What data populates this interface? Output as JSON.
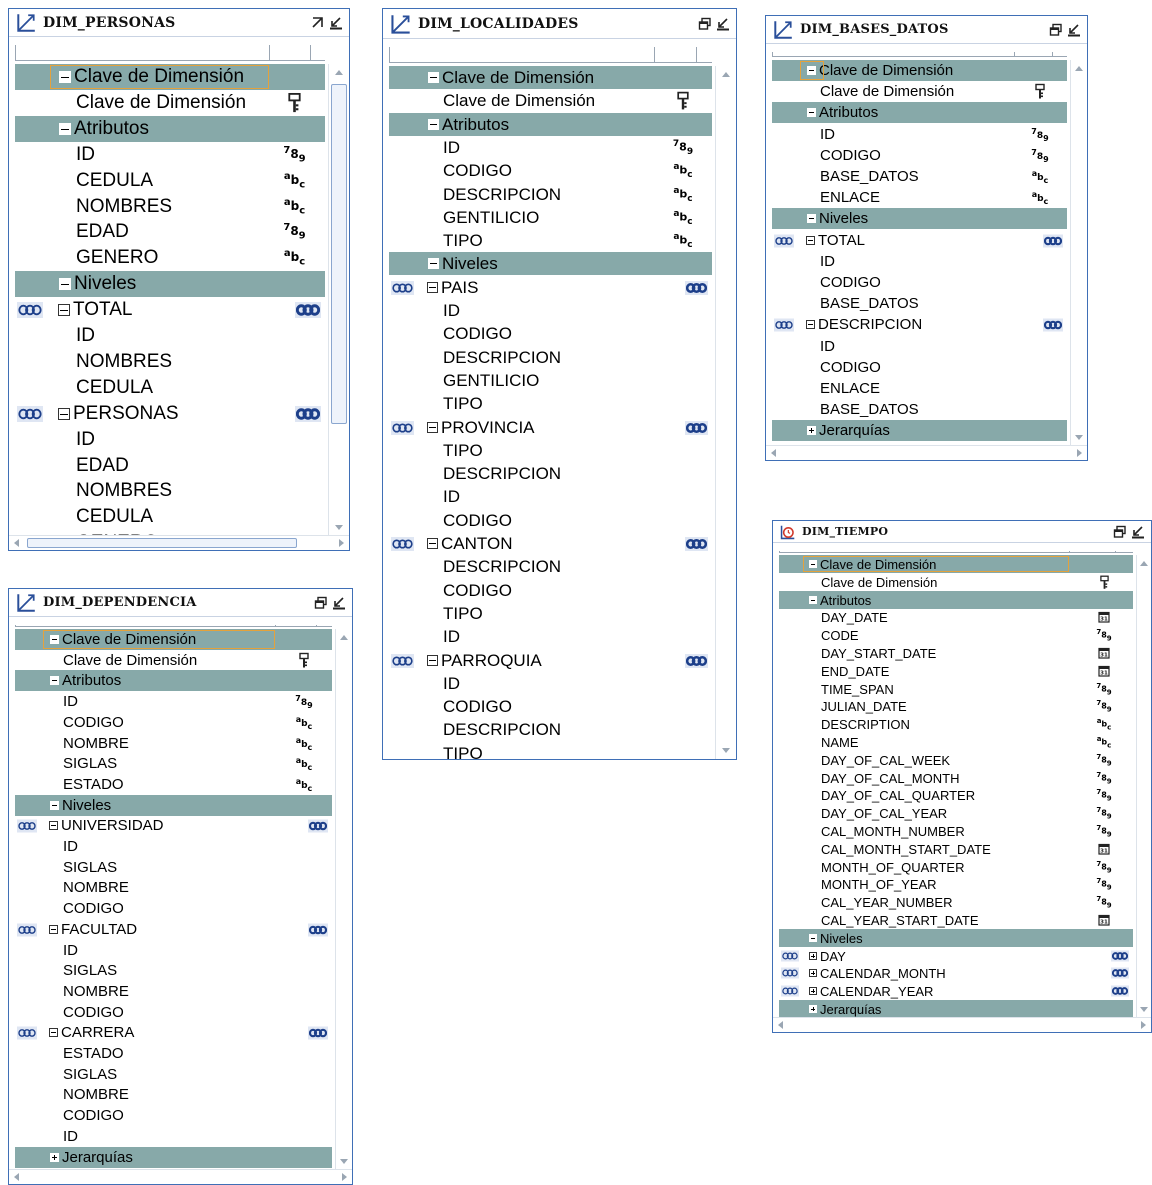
{
  "panels": [
    {
      "id": "dim-personas",
      "title": "DIM_PERSONAS",
      "badge_button": "arrow",
      "sections": [
        {
          "label": "Clave de Dimensión",
          "state": "expanded",
          "selected": true
        },
        {
          "label": "Clave de Dimensión",
          "type": "key"
        },
        {
          "label": "Atributos",
          "state": "expanded"
        },
        {
          "label": "ID",
          "type": "number"
        },
        {
          "label": "CEDULA",
          "type": "text"
        },
        {
          "label": "NOMBRES",
          "type": "text"
        },
        {
          "label": "EDAD",
          "type": "number"
        },
        {
          "label": "GENERO",
          "type": "text"
        },
        {
          "label": "Niveles",
          "state": "expanded"
        },
        {
          "label": "TOTAL",
          "level": true,
          "state": "expanded"
        },
        {
          "label": "ID"
        },
        {
          "label": "NOMBRES"
        },
        {
          "label": "CEDULA"
        },
        {
          "label": "PERSONAS",
          "level": true,
          "state": "expanded"
        },
        {
          "label": "ID"
        },
        {
          "label": "EDAD"
        },
        {
          "label": "NOMBRES"
        },
        {
          "label": "CEDULA"
        },
        {
          "label": "GENERO"
        }
      ]
    },
    {
      "id": "dim-localidades",
      "title": "DIM_LOCALIDADES",
      "sections": [
        {
          "label": "Clave de Dimensión",
          "state": "expanded"
        },
        {
          "label": "Clave de Dimensión",
          "type": "key"
        },
        {
          "label": "Atributos",
          "state": "expanded"
        },
        {
          "label": "ID",
          "type": "number"
        },
        {
          "label": "CODIGO",
          "type": "text"
        },
        {
          "label": "DESCRIPCION",
          "type": "text"
        },
        {
          "label": "GENTILICIO",
          "type": "text"
        },
        {
          "label": "TIPO",
          "type": "text"
        },
        {
          "label": "Niveles",
          "state": "expanded"
        },
        {
          "label": "PAIS",
          "level": true,
          "state": "expanded"
        },
        {
          "label": "ID"
        },
        {
          "label": "CODIGO"
        },
        {
          "label": "DESCRIPCION"
        },
        {
          "label": "GENTILICIO"
        },
        {
          "label": "TIPO"
        },
        {
          "label": "PROVINCIA",
          "level": true,
          "state": "expanded"
        },
        {
          "label": "TIPO"
        },
        {
          "label": "DESCRIPCION"
        },
        {
          "label": "ID"
        },
        {
          "label": "CODIGO"
        },
        {
          "label": "CANTON",
          "level": true,
          "state": "expanded"
        },
        {
          "label": "DESCRIPCION"
        },
        {
          "label": "CODIGO"
        },
        {
          "label": "TIPO"
        },
        {
          "label": "ID"
        },
        {
          "label": "PARROQUIA",
          "level": true,
          "state": "expanded"
        },
        {
          "label": "ID"
        },
        {
          "label": "CODIGO"
        },
        {
          "label": "DESCRIPCION"
        },
        {
          "label": "TIPO"
        }
      ]
    },
    {
      "id": "dim-bases-datos",
      "title": "DIM_BASES_DATOS",
      "sections": [
        {
          "label": "Clave de Dimensión",
          "state": "expanded",
          "selected": true
        },
        {
          "label": "Clave de Dimensión",
          "type": "key"
        },
        {
          "label": "Atributos",
          "state": "expanded"
        },
        {
          "label": "ID",
          "type": "number"
        },
        {
          "label": "CODIGO",
          "type": "number"
        },
        {
          "label": "BASE_DATOS",
          "type": "text"
        },
        {
          "label": "ENLACE",
          "type": "text"
        },
        {
          "label": "Niveles",
          "state": "expanded"
        },
        {
          "label": "TOTAL",
          "level": true,
          "state": "expanded"
        },
        {
          "label": "ID"
        },
        {
          "label": "CODIGO"
        },
        {
          "label": "BASE_DATOS"
        },
        {
          "label": "DESCRIPCION",
          "level": true,
          "state": "expanded"
        },
        {
          "label": "ID"
        },
        {
          "label": "CODIGO"
        },
        {
          "label": "ENLACE"
        },
        {
          "label": "BASE_DATOS"
        },
        {
          "label": "Jerarquías",
          "state": "collapsed"
        }
      ]
    },
    {
      "id": "dim-dependencia",
      "title": "DIM_DEPENDENCIA",
      "sections": [
        {
          "label": "Clave de Dimensión",
          "state": "expanded",
          "selected": true
        },
        {
          "label": "Clave de Dimensión",
          "type": "key"
        },
        {
          "label": "Atributos",
          "state": "expanded"
        },
        {
          "label": "ID",
          "type": "number"
        },
        {
          "label": "CODIGO",
          "type": "text"
        },
        {
          "label": "NOMBRE",
          "type": "text"
        },
        {
          "label": "SIGLAS",
          "type": "text"
        },
        {
          "label": "ESTADO",
          "type": "text"
        },
        {
          "label": "Niveles",
          "state": "expanded"
        },
        {
          "label": "UNIVERSIDAD",
          "level": true,
          "state": "expanded"
        },
        {
          "label": "ID"
        },
        {
          "label": "SIGLAS"
        },
        {
          "label": "NOMBRE"
        },
        {
          "label": "CODIGO"
        },
        {
          "label": "FACULTAD",
          "level": true,
          "state": "expanded"
        },
        {
          "label": "ID"
        },
        {
          "label": "SIGLAS"
        },
        {
          "label": "NOMBRE"
        },
        {
          "label": "CODIGO"
        },
        {
          "label": "CARRERA",
          "level": true,
          "state": "expanded"
        },
        {
          "label": "ESTADO"
        },
        {
          "label": "SIGLAS"
        },
        {
          "label": "NOMBRE"
        },
        {
          "label": "CODIGO"
        },
        {
          "label": "ID"
        },
        {
          "label": "Jerarquías",
          "state": "collapsed"
        }
      ]
    },
    {
      "id": "dim-tiempo",
      "title": "DIM_TIEMPO",
      "sections": [
        {
          "label": "Clave de Dimensión",
          "state": "expanded",
          "selected": true
        },
        {
          "label": "Clave de Dimensión",
          "type": "key"
        },
        {
          "label": "Atributos",
          "state": "expanded"
        },
        {
          "label": "DAY_DATE",
          "type": "date"
        },
        {
          "label": "CODE",
          "type": "number"
        },
        {
          "label": "DAY_START_DATE",
          "type": "date"
        },
        {
          "label": "END_DATE",
          "type": "date"
        },
        {
          "label": "TIME_SPAN",
          "type": "number"
        },
        {
          "label": "JULIAN_DATE",
          "type": "number"
        },
        {
          "label": "DESCRIPTION",
          "type": "text"
        },
        {
          "label": "NAME",
          "type": "text"
        },
        {
          "label": "DAY_OF_CAL_WEEK",
          "type": "number"
        },
        {
          "label": "DAY_OF_CAL_MONTH",
          "type": "number"
        },
        {
          "label": "DAY_OF_CAL_QUARTER",
          "type": "number"
        },
        {
          "label": "DAY_OF_CAL_YEAR",
          "type": "number"
        },
        {
          "label": "CAL_MONTH_NUMBER",
          "type": "number"
        },
        {
          "label": "CAL_MONTH_START_DATE",
          "type": "date"
        },
        {
          "label": "MONTH_OF_QUARTER",
          "type": "number"
        },
        {
          "label": "MONTH_OF_YEAR",
          "type": "number"
        },
        {
          "label": "CAL_YEAR_NUMBER",
          "type": "number"
        },
        {
          "label": "CAL_YEAR_START_DATE",
          "type": "date"
        },
        {
          "label": "Niveles",
          "state": "expanded"
        },
        {
          "label": "DAY",
          "level": true,
          "state": "collapsed"
        },
        {
          "label": "CALENDAR_MONTH",
          "level": true,
          "state": "collapsed"
        },
        {
          "label": "CALENDAR_YEAR",
          "level": true,
          "state": "collapsed"
        },
        {
          "label": "Jerarquías",
          "state": "collapsed"
        }
      ]
    }
  ],
  "type_glyphs": {
    "key": "key-icon",
    "number": "789",
    "text": "abc",
    "date": "31",
    "level": "hierarchy-chain-icon"
  },
  "colors": {
    "section_bg": "#87a9a9",
    "border": "#3f6fb6",
    "selection": "#e4a23c",
    "level_icon_bg": "#dfe6f3"
  }
}
